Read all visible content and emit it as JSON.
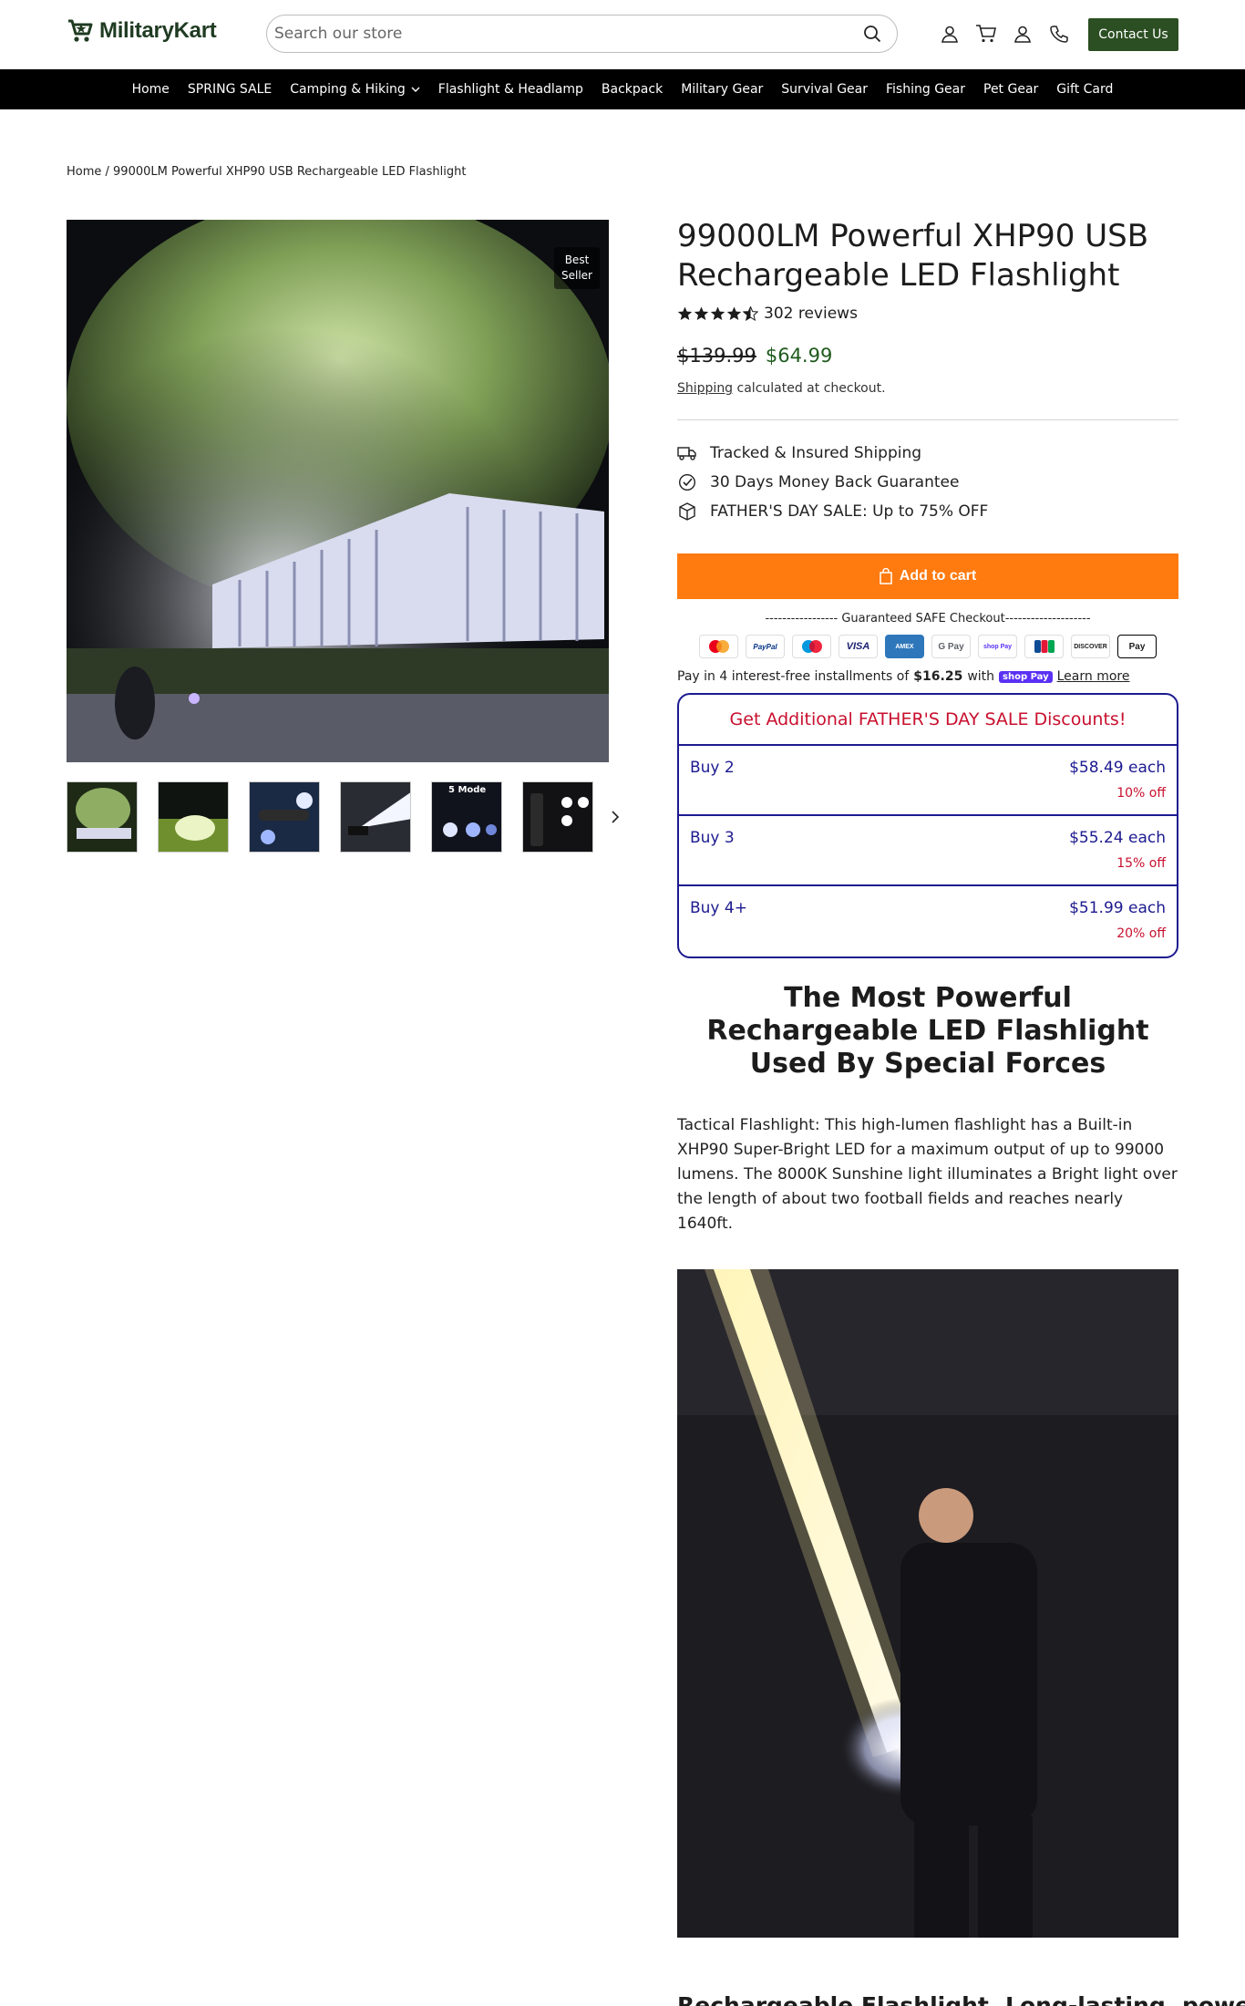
{
  "header": {
    "logo_text": "MilitaryKart",
    "search_placeholder": "Search our store",
    "contact_label": "Contact Us"
  },
  "nav": {
    "items": [
      "Home",
      "SPRING SALE",
      "Camping & Hiking",
      "Flashlight & Headlamp",
      "Backpack",
      "Military Gear",
      "Survival Gear",
      "Fishing Gear",
      "Pet Gear",
      "Gift Card"
    ]
  },
  "breadcrumb": "Home / 99000LM Powerful XHP90 USB Rechargeable LED Flashlight",
  "gallery": {
    "badge": "Best Seller",
    "thumb_labels": [
      "",
      "",
      "",
      "",
      "5 Mode",
      ""
    ]
  },
  "product": {
    "title": "99000LM Powerful XHP90 USB Rechargeable LED Flashlight",
    "rating": 4.5,
    "reviews": "302 reviews",
    "price_old": "$139.99",
    "price_new": "$64.99",
    "shipping_link": "Shipping",
    "shipping_rest": " calculated at checkout.",
    "features": [
      {
        "icon": "truck-icon",
        "text": "Tracked & Insured Shipping"
      },
      {
        "icon": "check-circle-icon",
        "text": "30 Days Money Back Guarantee"
      },
      {
        "icon": "box-icon",
        "text": "FATHER'S DAY SALE: Up to 75% OFF"
      }
    ],
    "add_to_cart": "Add to cart",
    "checkout_note": "----------------- Guaranteed SAFE Checkout--------------------",
    "payment_methods": [
      "mastercard",
      "PayPal",
      "maestro",
      "VISA",
      "AMEX",
      "G Pay",
      "shop Pay",
      "JCB",
      "DISCOVER",
      "Apple Pay"
    ],
    "installments_prefix": "Pay in 4 interest-free installments of",
    "installments_amount": "$16.25",
    "installments_with": "with",
    "shop_pay": "shop Pay",
    "learn_more": "Learn more"
  },
  "bundle": {
    "heading": "Get Additional FATHER'S DAY SALE Discounts!",
    "rows": [
      {
        "label": "Buy 2",
        "price": "$58.49 each",
        "off": "10% off"
      },
      {
        "label": "Buy 3",
        "price": "$55.24 each",
        "off": "15% off"
      },
      {
        "label": "Buy 4+",
        "price": "$51.99 each",
        "off": "20% off"
      }
    ]
  },
  "description": {
    "heading": "The Most Powerful Rechargeable LED Flashlight Used By Special Forces",
    "text": "Tactical Flashlight: This high-lumen flashlight has a Built-in XHP90 Super-Bright LED for a maximum output of up to 99000 lumens. The 8000K Sunshine light illuminates a Bright light over the length of about two football fields and reaches nearly 1640ft.",
    "heading2": "Rechargeable Flashlight, Long-lasting, power"
  },
  "colors": {
    "brand_green": "#2b4e22",
    "accent_orange": "#ff7a0f",
    "bundle_blue": "#1c1a8f",
    "sale_red": "#c8102e"
  }
}
